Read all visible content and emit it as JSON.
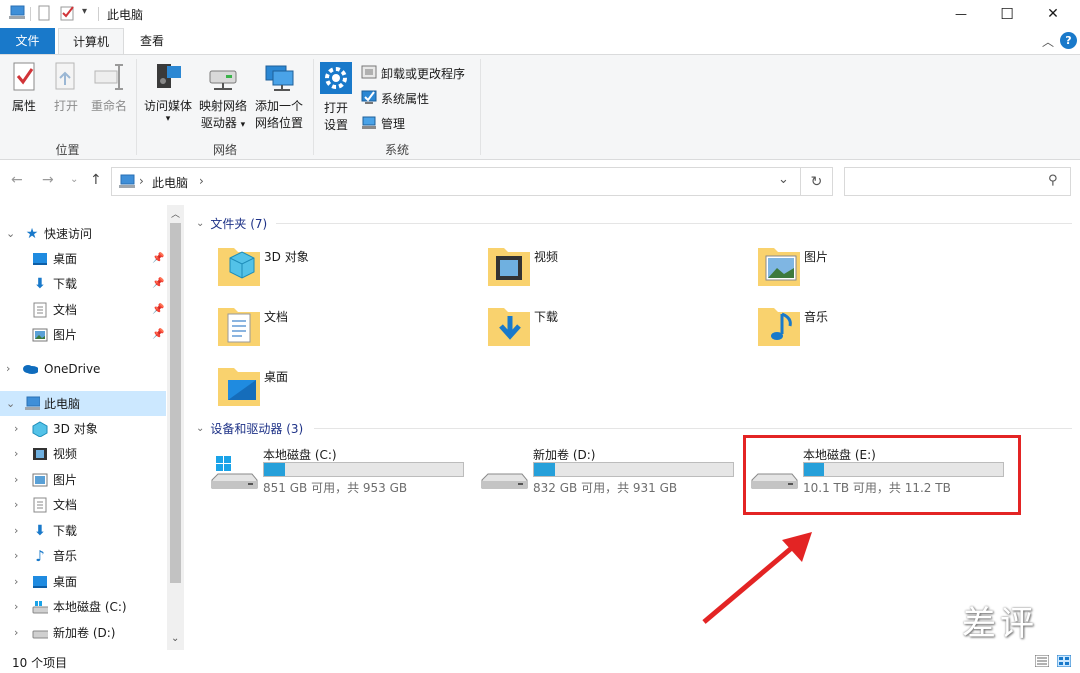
{
  "window": {
    "title": "此电脑",
    "minimize": "—",
    "maximize": "☐",
    "close": "✕"
  },
  "ribbon_tabs": {
    "file": "文件",
    "computer": "计算机",
    "view": "查看"
  },
  "ribbon": {
    "location": {
      "label": "位置",
      "properties": "属性",
      "open": "打开",
      "rename": "重命名"
    },
    "network": {
      "label": "网络",
      "media_line1": "访问媒体",
      "map_line1": "映射网络",
      "map_line2": "驱动器",
      "add_line1": "添加一个",
      "add_line2": "网络位置"
    },
    "system": {
      "label": "系统",
      "settings_line1": "打开",
      "settings_line2": "设置",
      "uninstall": "卸载或更改程序",
      "sys_props": "系统属性",
      "manage": "管理"
    }
  },
  "address": {
    "path": "此电脑"
  },
  "nav": {
    "quick_access": "快速访问",
    "quick_items": [
      "桌面",
      "下载",
      "文档",
      "图片"
    ],
    "onedrive": "OneDrive",
    "this_pc": "此电脑",
    "pc_items": [
      "3D 对象",
      "视频",
      "图片",
      "文档",
      "下载",
      "音乐",
      "桌面",
      "本地磁盘 (C:)",
      "新加卷 (D:)"
    ]
  },
  "folders_section": {
    "header": "文件夹 (7)"
  },
  "folders": [
    "3D 对象",
    "视频",
    "图片",
    "文档",
    "下载",
    "音乐",
    "桌面"
  ],
  "drives_section": {
    "header": "设备和驱动器 (3)"
  },
  "drives": [
    {
      "name": "本地磁盘 (C:)",
      "free": "851 GB 可用，共 953 GB",
      "used_fraction": 0.107
    },
    {
      "name": "新加卷 (D:)",
      "free": "832 GB 可用，共 931 GB",
      "used_fraction": 0.106
    },
    {
      "name": "本地磁盘 (E:)",
      "free": "10.1 TB 可用，共 11.2 TB",
      "used_fraction": 0.098
    }
  ],
  "status": {
    "items_count": "10 个项目"
  },
  "watermark": "差评",
  "colors": {
    "accent": "#1979ca",
    "highlight_box": "#e32424",
    "bar_fill": "#26a0da",
    "selected_nav": "#cce8ff"
  }
}
